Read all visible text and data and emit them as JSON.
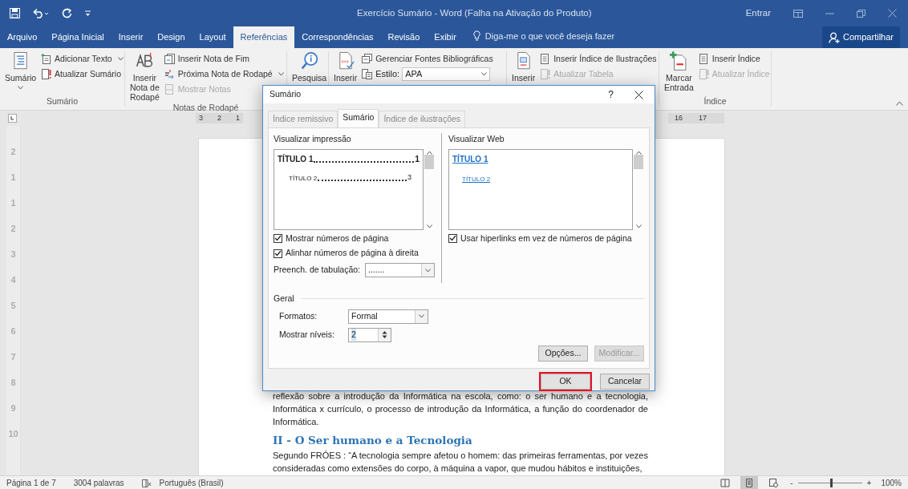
{
  "title_bar": {
    "title": "Exercício Sumário  -  Word (Falha na Ativação do Produto)",
    "sign_in": "Entrar"
  },
  "ribbon_tabs": [
    {
      "label": "Arquivo",
      "selected": false
    },
    {
      "label": "Página Inicial",
      "selected": false
    },
    {
      "label": "Inserir",
      "selected": false
    },
    {
      "label": "Design",
      "selected": false
    },
    {
      "label": "Layout",
      "selected": false
    },
    {
      "label": "Referências",
      "selected": true
    },
    {
      "label": "Correspondências",
      "selected": false
    },
    {
      "label": "Revisão",
      "selected": false
    },
    {
      "label": "Exibir",
      "selected": false
    }
  ],
  "tell_me": {
    "placeholder": "Diga-me o que você deseja fazer"
  },
  "share_button": "Compartilhar",
  "ribbon_groups": [
    {
      "label": "Sumário",
      "commands": [
        {
          "kind": "large",
          "label": "Sumário",
          "dropdown": true,
          "disabled": false
        },
        {
          "kind": "small",
          "label": "Adicionar Texto",
          "dropdown": true,
          "disabled": false
        },
        {
          "kind": "small",
          "label": "Atualizar Sumário",
          "dropdown": false,
          "disabled": false
        }
      ]
    },
    {
      "label": "Notas de Rodapé",
      "commands": [
        {
          "kind": "large",
          "label": "Inserir Nota de Rodapé",
          "dropdown": false,
          "disabled": false
        },
        {
          "kind": "small",
          "label": "Inserir Nota de Fim",
          "dropdown": false,
          "disabled": false
        },
        {
          "kind": "small",
          "label": "Próxima Nota de Rodapé",
          "dropdown": true,
          "disabled": false
        },
        {
          "kind": "small",
          "label": "Mostrar Notas",
          "dropdown": false,
          "disabled": true
        }
      ]
    },
    {
      "commands": [
        {
          "kind": "large",
          "label": "Pesquisa",
          "disabled": false
        }
      ]
    },
    {
      "commands": [
        {
          "kind": "large",
          "label": "Inserir",
          "disabled": false
        },
        {
          "kind": "small",
          "label": "Gerenciar Fontes Bibliográficas",
          "dropdown": false,
          "disabled": false
        },
        {
          "kind": "combo",
          "label": "Estilo:",
          "value": "APA",
          "dropdown": true,
          "disabled": false
        }
      ]
    },
    {
      "commands": [
        {
          "kind": "large",
          "label": "Inserir",
          "disabled": false
        },
        {
          "kind": "small",
          "label": "Inserir Índice de Ilustrações",
          "dropdown": false,
          "disabled": false
        },
        {
          "kind": "small",
          "label": "Atualizar Tabela",
          "dropdown": false,
          "disabled": true
        }
      ]
    },
    {
      "label": "Índice",
      "commands": [
        {
          "kind": "large",
          "label": "Marcar Entrada",
          "dropdown": false,
          "disabled": false
        },
        {
          "kind": "small",
          "label": "Inserir Índice",
          "dropdown": false,
          "disabled": false
        },
        {
          "kind": "small",
          "label": "Atualizar Índice",
          "dropdown": false,
          "disabled": true
        }
      ]
    }
  ],
  "horizontal_ruler": {
    "left_numbers": [
      "3",
      "2",
      "1"
    ],
    "right_numbers": [
      "16",
      "17"
    ]
  },
  "vertical_ruler": {
    "numbers": [
      "2",
      "1",
      "1",
      "2",
      "3",
      "4",
      "5",
      "6",
      "7",
      "8",
      "9",
      "10"
    ]
  },
  "document": {
    "blocks": [
      {
        "kind": "paragraph",
        "text": "reflexão sobre a introdução da Informática na escola, como: o ser humano e a tecnologia, Informática x currículo, o processo de introdução da Informática, a função do coordenador de Informática."
      },
      {
        "kind": "heading",
        "text": "II - O Ser humano e a Tecnologia"
      },
      {
        "kind": "paragraph",
        "text": "Segundo FRÓES : “A tecnologia sempre afetou o homem: das primeiras ferramentas, por vezes consideradas como extensões do corpo, à máquina a vapor, que mudou hábitos e instituições,"
      }
    ]
  },
  "dialog": {
    "title": "Sumário",
    "help": "?",
    "tabs": [
      {
        "label": "Índice remissivo",
        "selected": false
      },
      {
        "label": "Sumário",
        "selected": true
      },
      {
        "label": "Índice de ilustrações",
        "selected": false
      }
    ],
    "print_preview": {
      "label": "Visualizar impressão",
      "entries": [
        {
          "text": "TÍTULO 1",
          "page": "1",
          "children": [
            {
              "text": "TÍTULO 2",
              "page": "3"
            }
          ]
        }
      ]
    },
    "web_preview": {
      "label": "Visualizar Web",
      "entries": [
        {
          "text": "TÍTULO 1",
          "children": [
            {
              "text": "TÍTULO 2"
            }
          ]
        }
      ]
    },
    "left_checkboxes": [
      {
        "label": "Mostrar números de página",
        "checked": true
      },
      {
        "label": "Alinhar números de página à direita",
        "checked": true
      }
    ],
    "tab_leader": {
      "label": "Preench. de tabulação:",
      "value": "......."
    },
    "right_checkboxes": [
      {
        "label": "Usar hiperlinks em vez de números de página",
        "checked": true
      }
    ],
    "general": {
      "label": "Geral",
      "formats": {
        "label": "Formatos:",
        "value": "Formal"
      },
      "levels": {
        "label": "Mostrar níveis:",
        "value": "2"
      }
    },
    "panel_buttons": [
      {
        "label": "Opções...",
        "disabled": false
      },
      {
        "label": "Modificar...",
        "disabled": true
      }
    ],
    "buttons": [
      {
        "label": "OK",
        "highlighted": true
      },
      {
        "label": "Cancelar",
        "highlighted": false
      }
    ]
  },
  "status_bar": {
    "page": "Página 1 de 7",
    "words": "3004 palavras",
    "language": "Português (Brasil)",
    "views": [
      {
        "selected": false
      },
      {
        "selected": true
      },
      {
        "selected": false
      }
    ],
    "zoom": {
      "minus": "-",
      "plus": "+",
      "level": 0.5,
      "reading": "100%"
    }
  }
}
